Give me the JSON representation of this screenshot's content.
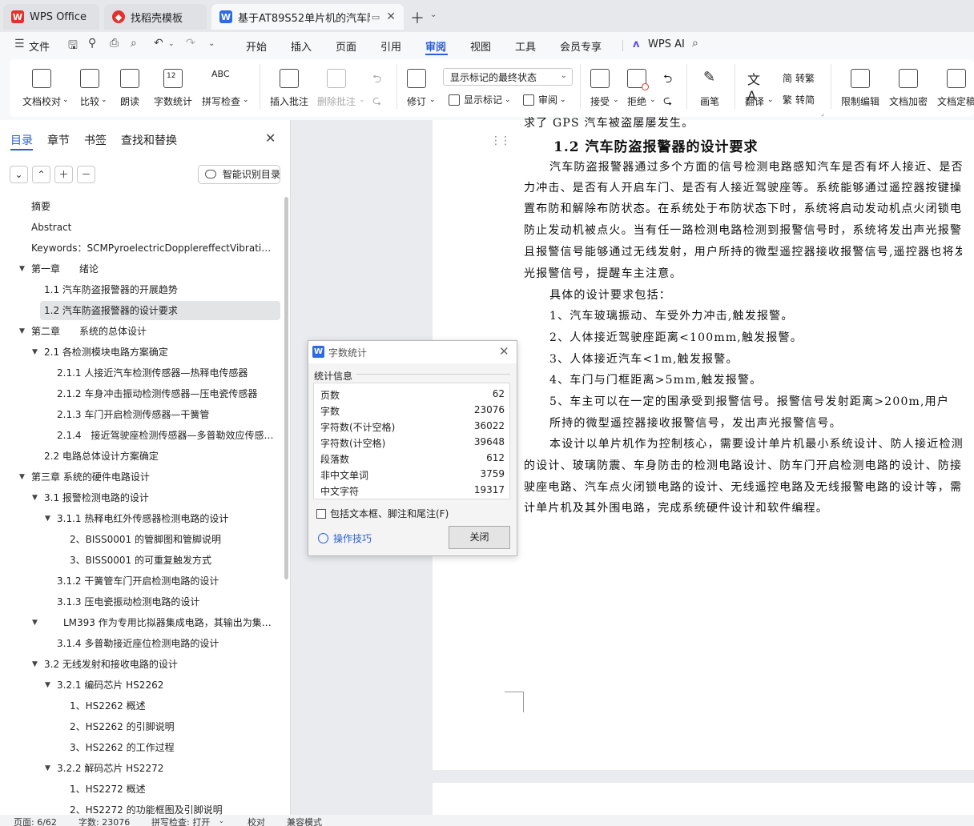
{
  "tabs": [
    {
      "label": "WPS Office",
      "icon": "wps-logo-icon",
      "color": "#e3322b"
    },
    {
      "label": "找稻壳模板",
      "icon": "docer-icon",
      "color": "#e3322b"
    },
    {
      "label": "基于AT89S52单片机的汽车防",
      "icon": "word-doc-icon",
      "color": "#2f6be0"
    }
  ],
  "menu": {
    "file": "文件",
    "items": [
      "开始",
      "插入",
      "页面",
      "引用",
      "审阅",
      "视图",
      "工具",
      "会员专享"
    ],
    "active": "审阅",
    "wps_ai": "WPS AI"
  },
  "ribbon": {
    "proofread": "文档校对",
    "compare": "比较",
    "read_aloud": "朗读",
    "word_count": "字数统计",
    "spell_check": "拼写检查",
    "add_comment": "插入批注",
    "delete_comment": "删除批注",
    "revise": "修订",
    "markup_select": "显示标记的最终状态",
    "show_markup": "显示标记",
    "review": "审阅",
    "accept": "接受",
    "reject": "拒绝",
    "ink": "画笔",
    "translate": "翻译",
    "to_traditional": "转繁",
    "to_simplified": "转简",
    "restrict_edit": "限制编辑",
    "encrypt": "文档加密",
    "finalize": "文档定稿"
  },
  "nav": {
    "tabs": [
      "目录",
      "章节",
      "书签",
      "查找和替换"
    ],
    "smart_button": "智能识别目录",
    "items": [
      "摘要",
      "Abstract",
      "Keywords：SCMPyroelectricDopplereffectVibratio ...",
      "第一章　　绪论",
      "1.1 汽车防盗报警器的开展趋势",
      "1.2 汽车防盗报警器的设计要求",
      "第二章　　系统的总体设计",
      "2.1 各检测模块电路方案确定",
      "2.1.1 人接近汽车检测传感器—热释电传感器",
      "2.1.2 车身冲击振动检测传感器—压电瓷传感器",
      "2.1.3 车门开启检测传感器—干簧管",
      "2.1.4　接近驾驶座检测传感器—多普勒效应传感 ...",
      "2.2 电路总体设计方案确定",
      "第三章 系统的硬件电路设计",
      "3.1 报警检测电路的设计",
      "3.1.1 热释电红外传感器检测电路的设计",
      "2、BISS0001 的管脚图和管脚说明",
      "3、BISS0001 的可重复触发方式",
      "3.1.2 干簧管车门开启检测电路的设计",
      "3.1.3 压电瓷振动检测电路的设计",
      "LM393 作为专用比拟器集成电路，其输出为集 ...",
      "3.1.4 多普勒接近座位检测电路的设计",
      "3.2 无线发射和接收电路的设计",
      "3.2.1 编码芯片 HS2262",
      "1、HS2262 概述",
      "2、HS2262 的引脚说明",
      "3、HS2262 的工作过程",
      "3.2.2 解码芯片 HS2272",
      "1、HS2272 概述",
      "2、HS2272 的功能框图及引脚说明"
    ]
  },
  "document": {
    "top_line": "求了 GPS 汽车被盗屡屡发生。",
    "heading": "1.2 汽车防盗报警器的设计要求",
    "lines": [
      "汽车防盗报警器通过多个方面的信号检测电路感知汽车是否有坏人接近、是否",
      "力冲击、是否有人开启车门、是否有人接近驾驶座等。系统能够通过遥控器按键操",
      "置布防和解除布防状态。在系统处于布防状态下时，系统将启动发动机点火闭锁电",
      "防止发动机被点火。当有任一路检测电路检测到报警信号时，系统将发出声光报警",
      "且报警信号能够通过无线发射，用户所持的微型遥控器接收报警信号,遥控器也将发",
      "光报警信号，提醒车主注意。",
      "具体的设计要求包括：",
      "1、汽车玻璃振动、车受外力冲击,触发报警。",
      "2、人体接近驾驶座距离<100mm,触发报警。",
      "3、人体接近汽车<1m,触发报警。",
      "4、车门与门框距离>5mm,触发报警。",
      "5、车主可以在一定的围承受到报警信号。报警信号发射距离>200m,用户",
      "所持的微型遥控器接收报警信号，发出声光报警信号。",
      "本设计以单片机作为控制核心，需要设计单片机最小系统设计、防人接近检测",
      "的设计、玻璃防震、车身防击的检测电路设计、防车门开启检测电路的设计、防接",
      "驶座电路、汽车点火闭锁电路的设计、无线遥控电路及无线报警电路的设计等，需",
      "计单片机及其外围电路，完成系统硬件设计和软件编程。"
    ]
  },
  "dialog": {
    "title": "字数统计",
    "section": "统计信息",
    "stats": [
      {
        "label": "页数",
        "value": "62"
      },
      {
        "label": "字数",
        "value": "23076"
      },
      {
        "label": "字符数(不计空格)",
        "value": "36022"
      },
      {
        "label": "字符数(计空格)",
        "value": "39648"
      },
      {
        "label": "段落数",
        "value": "612"
      },
      {
        "label": "非中文单词",
        "value": "3759"
      },
      {
        "label": "中文字符",
        "value": "19317"
      }
    ],
    "checkbox": "包括文本框、脚注和尾注(F)",
    "tips": "操作技巧",
    "close": "关闭"
  },
  "status": {
    "page": "页面: 6/62",
    "words": "字数: 23076",
    "spell": "拼写检查: 打开",
    "proof": "校对",
    "compat": "兼容模式"
  },
  "colors": {
    "accent": "#2b5fd9",
    "wps_red": "#e3322b",
    "word_blue": "#2f6be0"
  }
}
